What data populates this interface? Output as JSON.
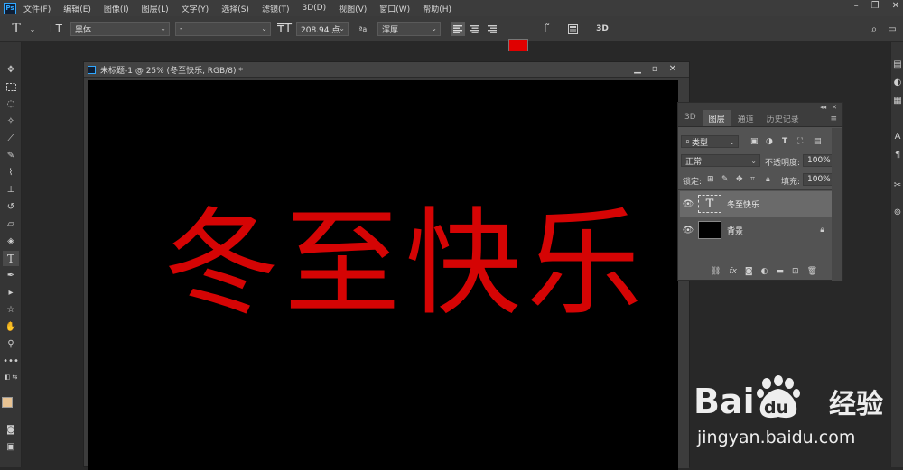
{
  "app": {
    "logo_text": "Ps"
  },
  "menu": [
    "文件(F)",
    "编辑(E)",
    "图像(I)",
    "图层(L)",
    "文字(Y)",
    "选择(S)",
    "滤镜(T)",
    "3D(D)",
    "视图(V)",
    "窗口(W)",
    "帮助(H)"
  ],
  "options": {
    "font_family": "黑体",
    "font_style": "-",
    "font_size": "208.94 点",
    "antialias": "浑厚",
    "text_color": "#e00000",
    "three_d_label": "3D"
  },
  "document": {
    "title": "未标题-1 @ 25% (冬至快乐, RGB/8) *",
    "canvas_text": "冬至快乐",
    "canvas_text_color": "#d50404"
  },
  "layers_panel": {
    "tabs": [
      "3D",
      "图层",
      "通道",
      "历史记录"
    ],
    "active_tab": "图层",
    "filter_kind": "类型",
    "blend_mode": "正常",
    "opacity_label": "不透明度:",
    "opacity_value": "100%",
    "lock_label": "锁定:",
    "fill_label": "填充:",
    "fill_value": "100%",
    "layers": [
      {
        "name": "冬至快乐",
        "type": "text",
        "thumb_glyph": "T",
        "selected": true
      },
      {
        "name": "背景",
        "type": "background",
        "locked": true
      }
    ]
  },
  "watermark": {
    "url": "jingyan.baidu.com"
  }
}
